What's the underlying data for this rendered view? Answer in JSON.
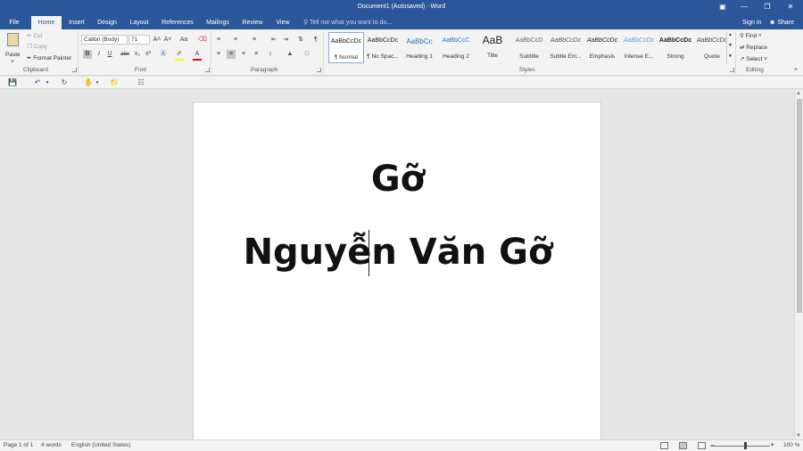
{
  "window": {
    "title": "Document1 (Autosaved) - Word"
  },
  "tabs": [
    {
      "label": "File"
    },
    {
      "label": "Home"
    },
    {
      "label": "Insert"
    },
    {
      "label": "Design"
    },
    {
      "label": "Layout"
    },
    {
      "label": "References"
    },
    {
      "label": "Mailings"
    },
    {
      "label": "Review"
    },
    {
      "label": "View"
    }
  ],
  "active_tab": "Home",
  "tell_me": {
    "placeholder": "Tell me what you want to do..."
  },
  "account": {
    "signin": "Sign in",
    "share": "Share"
  },
  "clipboard": {
    "paste": "Paste",
    "cut": "Cut",
    "copy": "Copy",
    "format_painter": "Format Painter",
    "label": "Clipboard"
  },
  "font": {
    "family": "Calibri (Body)",
    "size": "71",
    "label": "Font",
    "bold": "B",
    "italic": "I",
    "underline": "U",
    "strike": "abc",
    "subscript": "x₂",
    "superscript": "x²",
    "grow": "A˄",
    "shrink": "A˅",
    "case": "Aa",
    "color_a": "A"
  },
  "paragraph": {
    "label": "Paragraph"
  },
  "styles": {
    "label": "Styles",
    "items": [
      {
        "sample": "AaBbCcDc",
        "name": "¶ Normal"
      },
      {
        "sample": "AaBbCcDc",
        "name": "¶ No Spac..."
      },
      {
        "sample": "AaBbCc",
        "name": "Heading 1"
      },
      {
        "sample": "AaBbCcC",
        "name": "Heading 2"
      },
      {
        "sample": "AaB",
        "name": "Title"
      },
      {
        "sample": "AaBbCcD",
        "name": "Subtitle"
      },
      {
        "sample": "AaBbCcDc",
        "name": "Subtle Em..."
      },
      {
        "sample": "AaBbCcDc",
        "name": "Emphasis"
      },
      {
        "sample": "AaBbCcDc",
        "name": "Intense E..."
      },
      {
        "sample": "AaBbCcDc",
        "name": "Strong"
      },
      {
        "sample": "AaBbCcDc",
        "name": "Quote"
      }
    ]
  },
  "editing": {
    "label": "Editing",
    "find": "Find",
    "replace": "Replace",
    "select": "Select"
  },
  "document": {
    "line1": "Gỡ",
    "line2": "Nguyễn Văn Gỡ"
  },
  "status": {
    "page": "Page 1 of 1",
    "words": "4 words",
    "language": "English (United States)",
    "zoom": "100 %"
  },
  "colors": {
    "accent": "#2b579a",
    "ribbon": "#f3f3f3",
    "canvas": "#e6e6e6"
  }
}
